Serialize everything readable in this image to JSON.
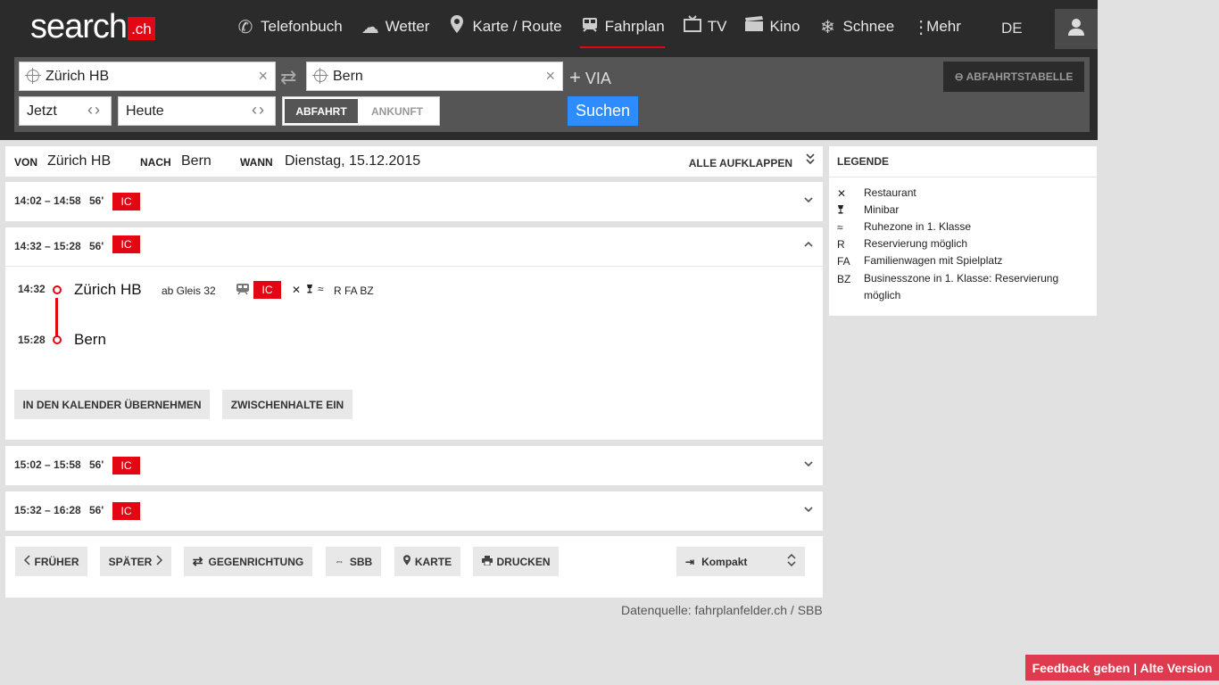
{
  "brand": {
    "word": "search",
    "tld": ".ch"
  },
  "nav": [
    {
      "label": "Telefonbuch",
      "icon": "phone-icon"
    },
    {
      "label": "Wetter",
      "icon": "weather-icon"
    },
    {
      "label": "Karte / Route",
      "icon": "map-pin-icon"
    },
    {
      "label": "Fahrplan",
      "icon": "train-icon",
      "active": true
    },
    {
      "label": "TV",
      "icon": "tv-icon"
    },
    {
      "label": "Kino",
      "icon": "film-icon"
    },
    {
      "label": "Schnee",
      "icon": "snowflake-icon"
    },
    {
      "label": "Mehr",
      "icon": "more-icon"
    }
  ],
  "lang": "DE",
  "form": {
    "from": "Zürich HB",
    "to": "Bern",
    "via": "VIA",
    "time": "Jetzt",
    "date": "Heute",
    "mode_on": "ABFAHRT",
    "mode_off": "ANKUNFT",
    "search": "Suchen",
    "abfahrtstabelle": "ABFAHRTSTABELLE"
  },
  "summary": {
    "von_label": "VON",
    "von": "Zürich HB",
    "nach_label": "NACH",
    "nach": "Bern",
    "wann_label": "WANN",
    "wann": "Dienstag, 15.12.2015",
    "expand_all": "ALLE AUFKLAPPEN"
  },
  "trips": [
    {
      "time": "14:02 – 14:58",
      "dur": "56'",
      "cat": "IC"
    },
    {
      "time": "14:32 – 15:28",
      "dur": "56'",
      "cat": "IC"
    },
    {
      "time": "15:02 – 15:58",
      "dur": "56'",
      "cat": "IC"
    },
    {
      "time": "15:32 – 16:28",
      "dur": "56'",
      "cat": "IC"
    }
  ],
  "detail": {
    "dep_time": "14:32",
    "dep_station": "Zürich HB",
    "platform": "ab Gleis 32",
    "cat": "IC",
    "amenities": "R  FA BZ",
    "arr_time": "15:28",
    "arr_station": "Bern",
    "btn_calendar": "IN DEN KALENDER ÜBERNEHMEN",
    "btn_stops": "ZWISCHENHALTE EIN"
  },
  "footer": {
    "earlier": "FRÜHER",
    "later": "SPÄTER",
    "reverse": "GEGENRICHTUNG",
    "sbb": "SBB",
    "map": "KARTE",
    "print": "DRUCKEN",
    "view": "Kompakt",
    "source": "Datenquelle: fahrplanfelder.ch / SBB"
  },
  "legend": {
    "title": "LEGENDE",
    "items": [
      {
        "sym": "✕",
        "desc": "Restaurant"
      },
      {
        "sym": "🍷",
        "desc": "Minibar"
      },
      {
        "sym": "≈",
        "desc": "Ruhezone in 1. Klasse"
      },
      {
        "sym": "R",
        "desc": "Reservierung möglich"
      },
      {
        "sym": "FA",
        "desc": "Familienwagen mit Spielplatz"
      },
      {
        "sym": "BZ",
        "desc": "Businesszone in 1. Klasse: Reservierung möglich"
      }
    ]
  },
  "feedback": "Feedback geben | Alte Version",
  "colors": {
    "accent": "#e30613",
    "button_blue": "#2d8cff",
    "topbar": "#2b2b2b",
    "feedback": "#e03a4e"
  }
}
